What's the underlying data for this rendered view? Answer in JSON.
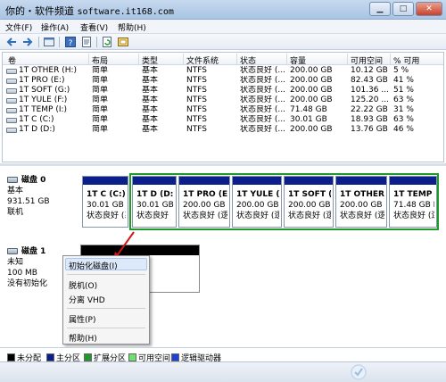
{
  "title_bar": {
    "site_name": "你的・软件频道",
    "url": "software.it168.com"
  },
  "menu": [
    {
      "label": "文件(F)"
    },
    {
      "label": "操作(A)"
    },
    {
      "label": "查看(V)"
    },
    {
      "label": "帮助(H)"
    }
  ],
  "toolbar_icons": [
    "back-arrow-icon",
    "forward-arrow-icon",
    "console-icon",
    "help-icon",
    "properties-icon",
    "refresh-icon",
    "export-icon"
  ],
  "volume_table": {
    "columns": [
      "卷",
      "布局",
      "类型",
      "文件系统",
      "状态",
      "容量",
      "可用空间",
      "% 可用"
    ],
    "rows": [
      [
        "1T OTHER (H:)",
        "简单",
        "基本",
        "NTFS",
        "状态良好 (...",
        "200.00 GB",
        "10.12 GB",
        "5 %"
      ],
      [
        "1T PRO (E:)",
        "简单",
        "基本",
        "NTFS",
        "状态良好 (...",
        "200.00 GB",
        "82.43 GB",
        "41 %"
      ],
      [
        "1T SOFT (G:)",
        "简单",
        "基本",
        "NTFS",
        "状态良好 (...",
        "200.00 GB",
        "101.36 ...",
        "51 %"
      ],
      [
        "1T YULE (F:)",
        "简单",
        "基本",
        "NTFS",
        "状态良好 (...",
        "200.00 GB",
        "125.20 ...",
        "63 %"
      ],
      [
        "1T TEMP (I:)",
        "简单",
        "基本",
        "NTFS",
        "状态良好 (...",
        "71.48 GB",
        "22.22 GB",
        "31 %"
      ],
      [
        "1T C (C:)",
        "简单",
        "基本",
        "NTFS",
        "状态良好 (...",
        "30.01 GB",
        "18.93 GB",
        "63 %"
      ],
      [
        "1T D (D:)",
        "简单",
        "基本",
        "NTFS",
        "状态良好 (...",
        "200.00 GB",
        "13.76 GB",
        "46 %"
      ]
    ]
  },
  "disk0": {
    "name": "磁盘 0",
    "type": "基本",
    "size": "931.51 GB",
    "status": "联机",
    "partitions": [
      {
        "name": "1T C (C:)",
        "size": "30.01 GB",
        "status": "状态良好 (系"
      },
      {
        "name": "1T D (D:)",
        "size": "30.01 GB",
        "status": "状态良好"
      },
      {
        "name": "1T PRO (E:)",
        "size": "200.00 GB N",
        "status": "状态良好 (逻"
      },
      {
        "name": "1T YULE (F:)",
        "size": "200.00 GB N",
        "status": "状态良好 (逻"
      },
      {
        "name": "1T SOFT (G:)",
        "size": "200.00 GB N",
        "status": "状态良好 (逻"
      },
      {
        "name": "1T OTHER (H:)",
        "size": "200.00 GB N",
        "status": "状态良好 (逻"
      },
      {
        "name": "1T TEMP (I:)",
        "size": "71.48 GB NT",
        "status": "状态良好 (逻"
      }
    ]
  },
  "disk1": {
    "name": "磁盘 1",
    "type": "未知",
    "size": "100 MB",
    "status": "没有初始化"
  },
  "context_menu": {
    "items": [
      {
        "label": "初始化磁盘(I)"
      },
      {
        "label": "脱机(O)"
      },
      {
        "label": "分离 VHD"
      },
      {
        "label": "属性(P)"
      },
      {
        "label": "帮助(H)"
      }
    ]
  },
  "legend": [
    {
      "label": "未分配",
      "color": "#000000"
    },
    {
      "label": "主分区",
      "color": "#0a1f8a"
    },
    {
      "label": "扩展分区",
      "color": "#1e9a2c"
    },
    {
      "label": "可用空间",
      "color": "#6ee06e"
    },
    {
      "label": "逻辑驱动器",
      "color": "#1f3fd6"
    }
  ],
  "colors": {
    "primary_partition": "#0a1f8a",
    "extended_partition": "#1e9a2c",
    "unallocated": "#000000"
  }
}
